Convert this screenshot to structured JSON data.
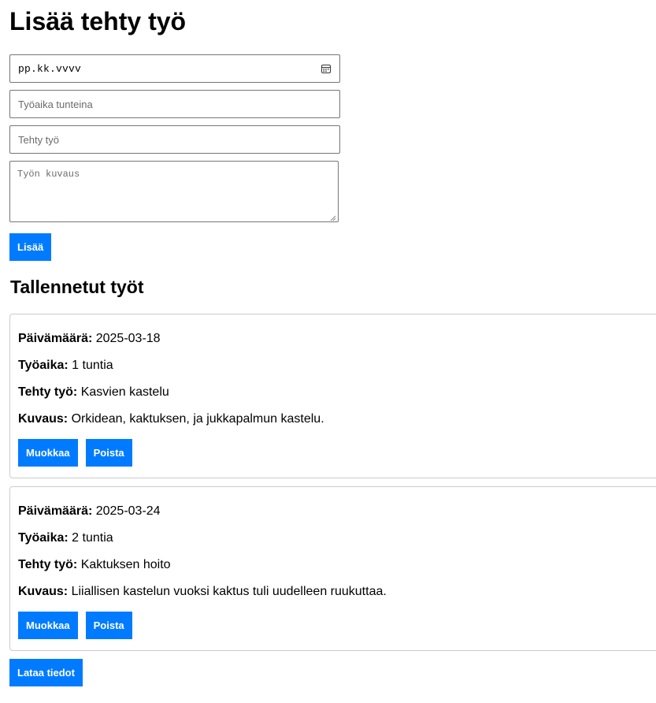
{
  "page": {
    "title": "Lisää tehty työ"
  },
  "form": {
    "date_placeholder": "pp.kk.vvvv",
    "hours_placeholder": "Työaika tunteina",
    "work_placeholder": "Tehty työ",
    "description_placeholder": "Työn kuvaus",
    "submit_label": "Lisää"
  },
  "saved": {
    "heading": "Tallennetut työt",
    "labels": {
      "date": "Päivämäärä:",
      "hours": "Työaika:",
      "work": "Tehty työ:",
      "description": "Kuvaus:"
    },
    "entries": [
      {
        "date": "2025-03-18",
        "hours": "1 tuntia",
        "work": "Kasvien kastelu",
        "description": "Orkidean, kaktuksen, ja jukkapalmun kastelu.",
        "edit_label": "Muokkaa",
        "delete_label": "Poista"
      },
      {
        "date": "2025-03-24",
        "hours": "2 tuntia",
        "work": "Kaktuksen hoito",
        "description": "Liiallisen kastelun vuoksi kaktus tuli uudelleen ruukuttaa.",
        "edit_label": "Muokkaa",
        "delete_label": "Poista"
      }
    ]
  },
  "download_label": "Lataa tiedot",
  "colors": {
    "accent": "#007bff",
    "border": "#cccccc"
  },
  "icons": {
    "date_picker": "calendar-icon",
    "textarea_resize": "resize-grip-icon"
  }
}
